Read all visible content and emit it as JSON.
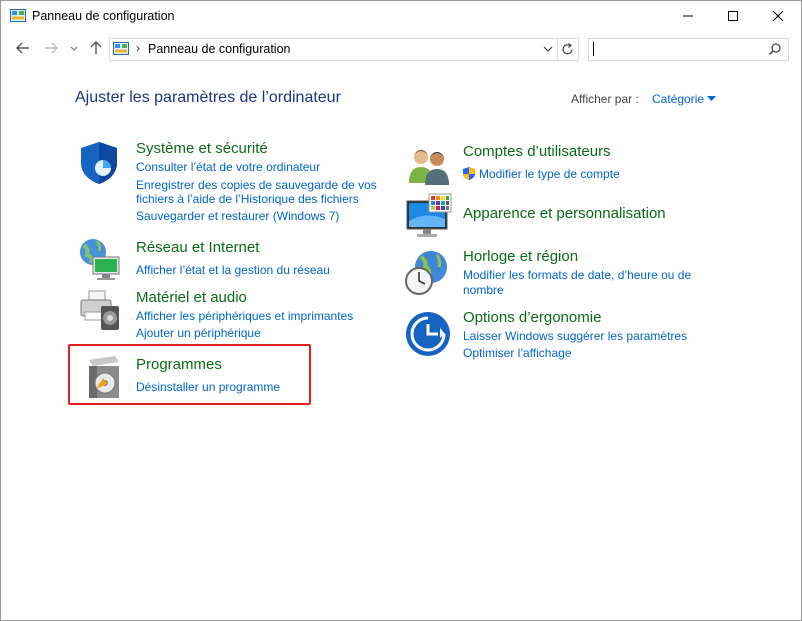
{
  "window": {
    "title": "Panneau de configuration"
  },
  "address": {
    "path": "Panneau de configuration",
    "search_placeholder": ""
  },
  "header": {
    "heading": "Ajuster les paramètres de l’ordinateur",
    "view_label": "Afficher par :",
    "view_value": "Catégorie"
  },
  "left": {
    "system": {
      "title": "Système et sécurité",
      "links": [
        "Consulter l’état de votre ordinateur",
        "Enregistrer des copies de sauvegarde de vos",
        "fichiers à l’aide de l’Historique des fichiers",
        "Sauvegarder et restaurer (Windows 7)"
      ]
    },
    "network": {
      "title": "Réseau et Internet",
      "links": [
        "Afficher l’état et la gestion du réseau"
      ]
    },
    "hardware": {
      "title": "Matériel et audio",
      "links": [
        "Afficher les périphériques et imprimantes",
        "Ajouter un périphérique"
      ]
    },
    "programs": {
      "title": "Programmes",
      "links": [
        "Désinstaller un programme"
      ]
    }
  },
  "right": {
    "accounts": {
      "title": "Comptes d’utilisateurs",
      "links": [
        "Modifier le type de compte"
      ]
    },
    "appearance": {
      "title": "Apparence et personnalisation"
    },
    "clock": {
      "title": "Horloge et région",
      "links": [
        "Modifier les formats de date, d’heure ou de",
        "nombre"
      ]
    },
    "ease": {
      "title": "Options d’ergonomie",
      "links": [
        "Laisser Windows suggérer les paramètres",
        "Optimiser l’affichage"
      ]
    }
  },
  "colors": {
    "category_title": "#0b6a19",
    "link": "#0066cc",
    "heading": "#1e3287",
    "highlight": "#e32020"
  }
}
